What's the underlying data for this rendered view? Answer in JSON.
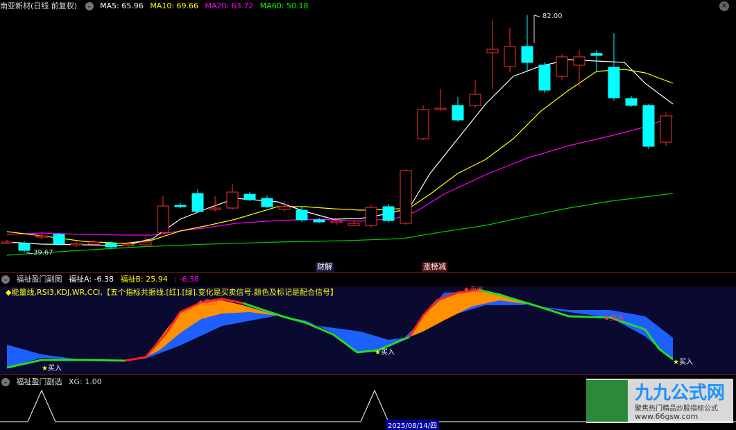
{
  "main": {
    "stock": "南亚新材(日线 前复权)",
    "ma5": "MA5: 65.96",
    "ma10": "MA10: 69.66",
    "ma20": "MA20: 63.72",
    "ma60": "MA60: 50.18",
    "high_label": "82.00",
    "low_label": "39.67",
    "event1": "财解",
    "event2": "涨榜减",
    "colors": {
      "ma5": "#ffffff",
      "ma10": "#ffff00",
      "ma20": "#ff00ff",
      "ma60": "#00ff00",
      "up": "#ff3030",
      "down": "#00ffff"
    }
  },
  "panel2": {
    "title": "福祉盈门副图",
    "a": "福祉A: -6.38",
    "b": "福祉B: 25.94",
    "c": ": -6.38",
    "desc": "◆能量线,RSI3,KDJ,WR,CCI,【五个指标共振线.[红].[绿].变化是买卖信号.颜色及标记是配合信号】",
    "buy": "买入",
    "sell": "卖出"
  },
  "panel3": {
    "title": "福祉盈门副选",
    "xg": "XG: 1.00",
    "date": "2025/08/14/四"
  },
  "brand": {
    "title": "九九公式网",
    "sub": "聚焦热门精品炒股指标公式",
    "url": "www.66gsw.com"
  }
}
